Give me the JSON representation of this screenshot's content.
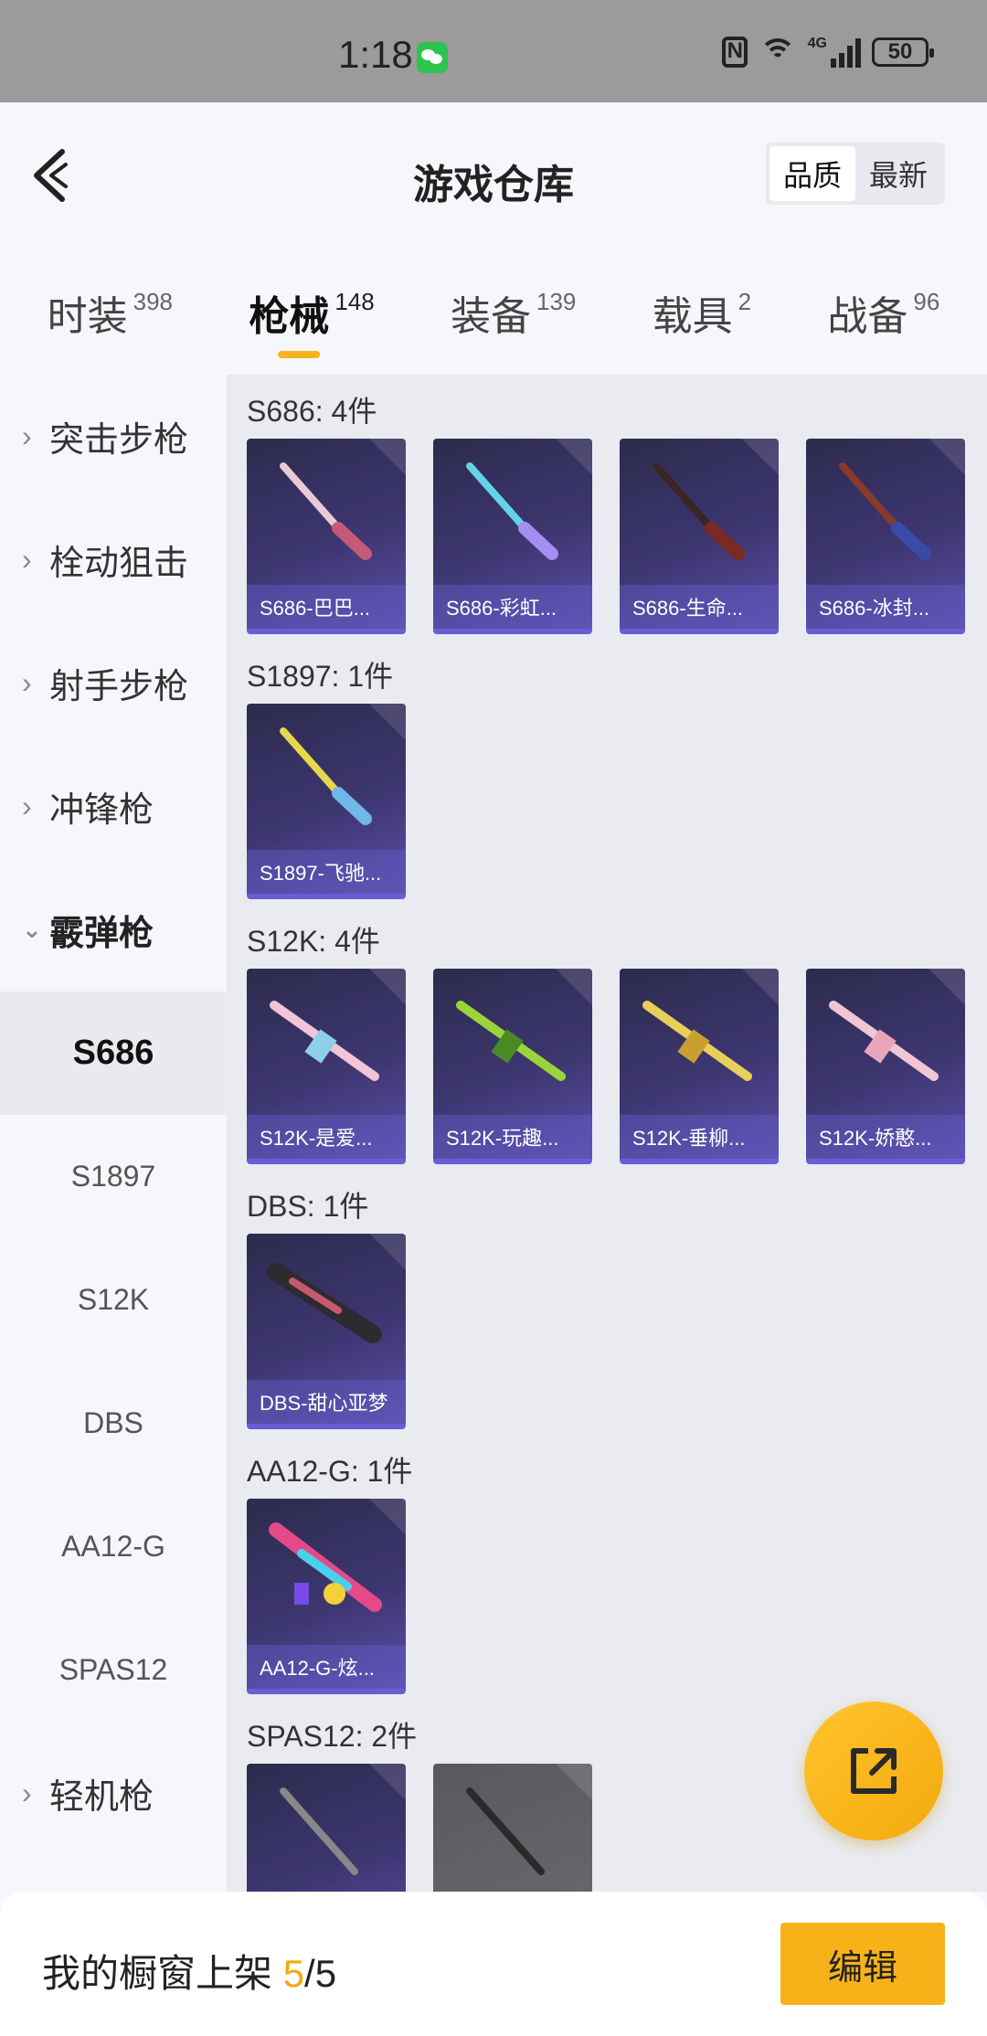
{
  "status_bar": {
    "time": "1:18",
    "network": "4G",
    "battery": "50"
  },
  "header": {
    "title": "游戏仓库",
    "sort_options": [
      "品质",
      "最新"
    ],
    "sort_active": "品质"
  },
  "tabs": [
    {
      "label": "时装",
      "count": "398"
    },
    {
      "label": "枪械",
      "count": "148",
      "active": true
    },
    {
      "label": "装备",
      "count": "139"
    },
    {
      "label": "载具",
      "count": "2"
    },
    {
      "label": "战备",
      "count": "96"
    }
  ],
  "sidebar": {
    "categories_top": [
      "突击步枪",
      "栓动狙击",
      "射手步枪",
      "冲锋枪"
    ],
    "open_category": "霰弹枪",
    "subitems": [
      "S686",
      "S1897",
      "S12K",
      "DBS",
      "AA12-G",
      "SPAS12"
    ],
    "active_sub": "S686",
    "categories_bottom": [
      "轻机枪"
    ]
  },
  "groups": [
    {
      "title": "S686: 4件",
      "items": [
        "S686-巴巴...",
        "S686-彩虹...",
        "S686-生命...",
        "S686-冰封..."
      ]
    },
    {
      "title": "S1897: 1件",
      "items": [
        "S1897-飞驰..."
      ]
    },
    {
      "title": "S12K: 4件",
      "items": [
        "S12K-是爱...",
        "S12K-玩趣...",
        "S12K-垂柳...",
        "S12K-娇憨..."
      ]
    },
    {
      "title": "DBS: 1件",
      "items": [
        "DBS-甜心亚梦"
      ]
    },
    {
      "title": "AA12-G: 1件",
      "items": [
        "AA12-G-炫..."
      ]
    },
    {
      "title": "SPAS12: 2件",
      "items": [
        "",
        ""
      ]
    }
  ],
  "bottom": {
    "shelf_label": "我的橱窗上架",
    "shelf_current": "5",
    "shelf_total": "/5",
    "edit_label": "编辑"
  },
  "colors": {
    "accent": "#f7b21a",
    "card_bg": "#3d3670",
    "card_border": "#6b5cd6"
  }
}
